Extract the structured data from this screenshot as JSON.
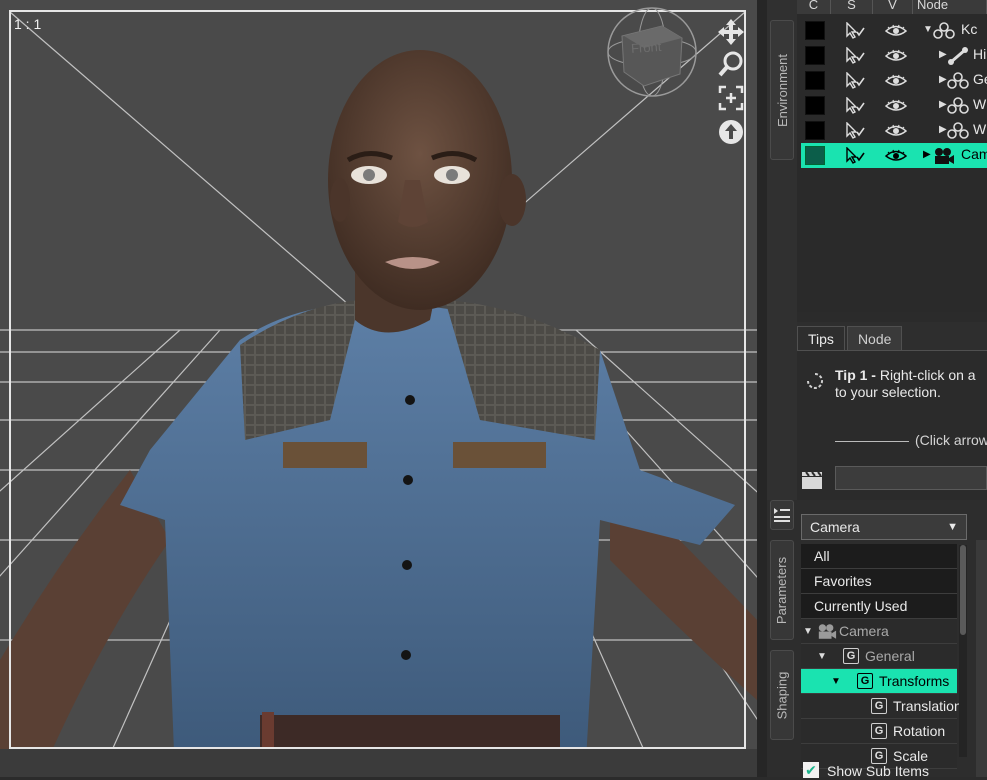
{
  "viewport": {
    "ratio_label": "1 : 1",
    "cube_face_label": "Front"
  },
  "side_tabs": {
    "environment": "Environment",
    "parameters": "Parameters",
    "shaping": "Shaping"
  },
  "scene": {
    "columns": [
      "C",
      "S",
      "V",
      "Node"
    ],
    "rows": [
      {
        "label": "Kc",
        "icon": "figure-icon",
        "depth": 0,
        "expanded": true,
        "selected": false
      },
      {
        "label": "Hi",
        "icon": "bone-icon",
        "depth": 1,
        "expanded": false,
        "selected": false
      },
      {
        "label": "Ge",
        "icon": "figure-icon",
        "depth": 1,
        "expanded": false,
        "selected": false
      },
      {
        "label": "W",
        "icon": "figure-icon",
        "depth": 1,
        "expanded": false,
        "selected": false
      },
      {
        "label": "W",
        "icon": "figure-icon",
        "depth": 1,
        "expanded": false,
        "selected": false
      },
      {
        "label": "Cam",
        "icon": "camera-icon",
        "depth": 0,
        "expanded": false,
        "selected": true
      }
    ]
  },
  "tips": {
    "tabs": [
      "Tips",
      "Node"
    ],
    "title_bold": "Tip 1 -",
    "title_rest": " Right-click on a",
    "line2": "to your selection.",
    "link_text": "(Click arrow"
  },
  "parameters": {
    "dropdown_value": "Camera",
    "flat_items": [
      "All",
      "Favorites",
      "Currently Used"
    ],
    "tree_items": [
      {
        "label": "Camera",
        "icon": "camera-icon",
        "depth": 0,
        "selected": false,
        "dim": true
      },
      {
        "label": "General",
        "icon": "group-icon",
        "depth": 1,
        "selected": false,
        "dim": true
      },
      {
        "label": "Transforms",
        "icon": "group-icon",
        "depth": 2,
        "selected": true,
        "dim": false
      },
      {
        "label": "Translation",
        "icon": "group-icon",
        "depth": 3,
        "selected": false,
        "dim": false
      },
      {
        "label": "Rotation",
        "icon": "group-icon",
        "depth": 3,
        "selected": false,
        "dim": false
      },
      {
        "label": "Scale",
        "icon": "group-icon",
        "depth": 3,
        "selected": false,
        "dim": false
      }
    ],
    "show_sub_items": "Show Sub Items",
    "show_sub_items_checked": true
  },
  "colors": {
    "accent": "#1ae3b0",
    "viewport_bg": "#4a4a4a",
    "panel_bg": "#2b2b2b"
  }
}
